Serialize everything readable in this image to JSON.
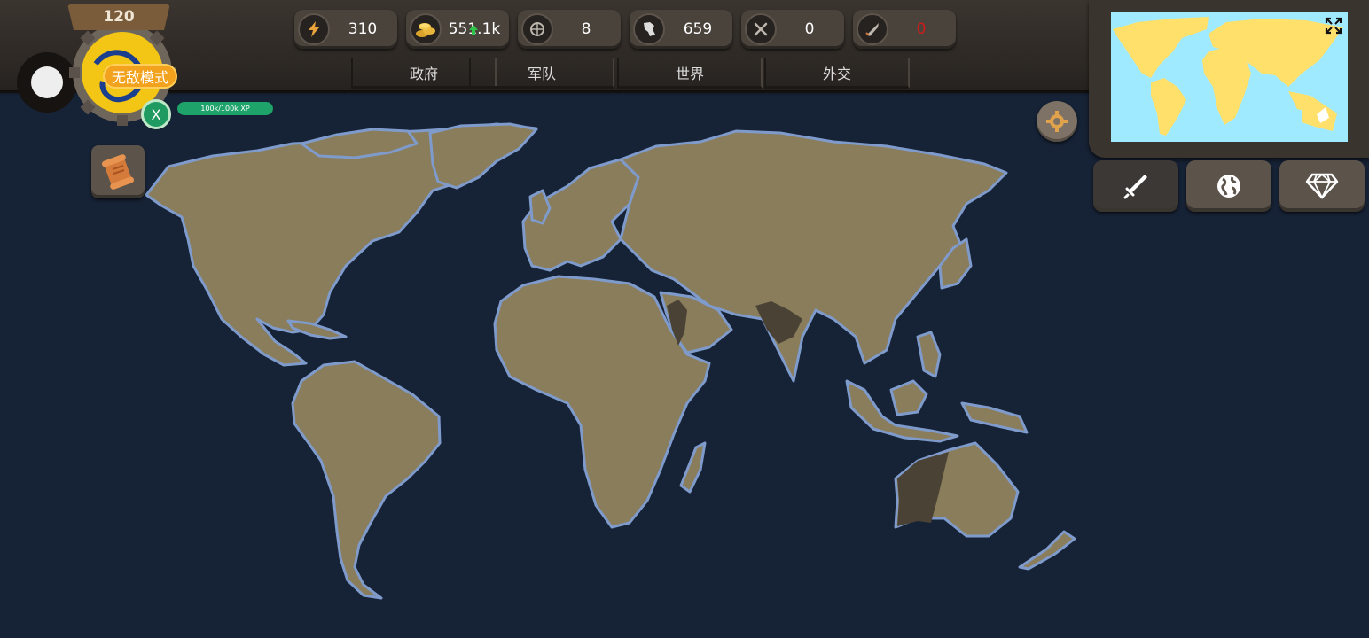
{
  "resources": [
    {
      "id": "energy",
      "icon": "lightning-icon",
      "value": "310"
    },
    {
      "id": "gold",
      "icon": "gold-coins-icon",
      "value": "551.1k"
    },
    {
      "id": "research",
      "icon": "globe-emblem-icon",
      "value": "8"
    },
    {
      "id": "territory",
      "icon": "territory-icon",
      "value": "659"
    },
    {
      "id": "battles",
      "icon": "crossed-swords-icon",
      "value": "0"
    },
    {
      "id": "weapons",
      "icon": "missile-icon",
      "value": "0",
      "color": "#d11a1a"
    }
  ],
  "tabs": [
    {
      "label": "政府"
    },
    {
      "label": "军队"
    },
    {
      "label": "世界"
    },
    {
      "label": "外交"
    }
  ],
  "profile": {
    "level": "120",
    "mode_badge": "无敌模式",
    "badge_letter": "X",
    "xp_text": "100k/100k XP",
    "xp_fraction": 1.0
  },
  "side_buttons": [
    {
      "icon": "sword-icon"
    },
    {
      "icon": "globe-icon"
    },
    {
      "icon": "diamond-icon"
    }
  ],
  "colors": {
    "ocean": "#162235",
    "land": "#8a7d5c",
    "owned_land": "#4a4235",
    "coast": "#7f9bcc",
    "minimap_water": "#9feaff",
    "minimap_land": "#ffe06b"
  }
}
